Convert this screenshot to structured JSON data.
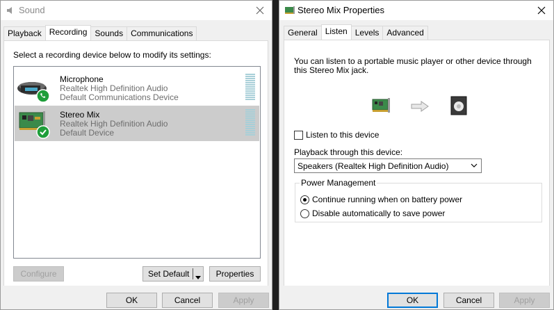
{
  "sound": {
    "title": "Sound",
    "tabs": [
      "Playback",
      "Recording",
      "Sounds",
      "Communications"
    ],
    "active_tab": "Recording",
    "instruction": "Select a recording device below to modify its settings:",
    "devices": [
      {
        "name": "Microphone",
        "driver": "Realtek High Definition Audio",
        "status": "Default Communications Device",
        "icon": "microphone-icon",
        "badge": "phone-badge-icon"
      },
      {
        "name": "Stereo Mix",
        "driver": "Realtek High Definition Audio",
        "status": "Default Device",
        "icon": "sound-card-icon",
        "badge": "check-badge-icon"
      }
    ],
    "configure_label": "Configure",
    "set_default_label": "Set Default",
    "properties_label": "Properties",
    "ok_label": "OK",
    "cancel_label": "Cancel",
    "apply_label": "Apply"
  },
  "props": {
    "title": "Stereo Mix Properties",
    "tabs": [
      "General",
      "Listen",
      "Levels",
      "Advanced"
    ],
    "active_tab": "Listen",
    "description": "You can listen to a portable music player or other device through this Stereo Mix jack.",
    "listen_label": "Listen to this device",
    "listen_checked": false,
    "playback_label": "Playback through this device:",
    "playback_value": "Speakers (Realtek High Definition Audio)",
    "power_group_label": "Power Management",
    "power_options": [
      "Continue running when on battery power",
      "Disable automatically to save power"
    ],
    "power_selected": 0,
    "ok_label": "OK",
    "cancel_label": "Cancel",
    "apply_label": "Apply"
  },
  "colors": {
    "selection": "#cccccc",
    "accent": "#0078d7",
    "badge_green": "#1e9e3a",
    "meter": "#a8cfd8"
  }
}
